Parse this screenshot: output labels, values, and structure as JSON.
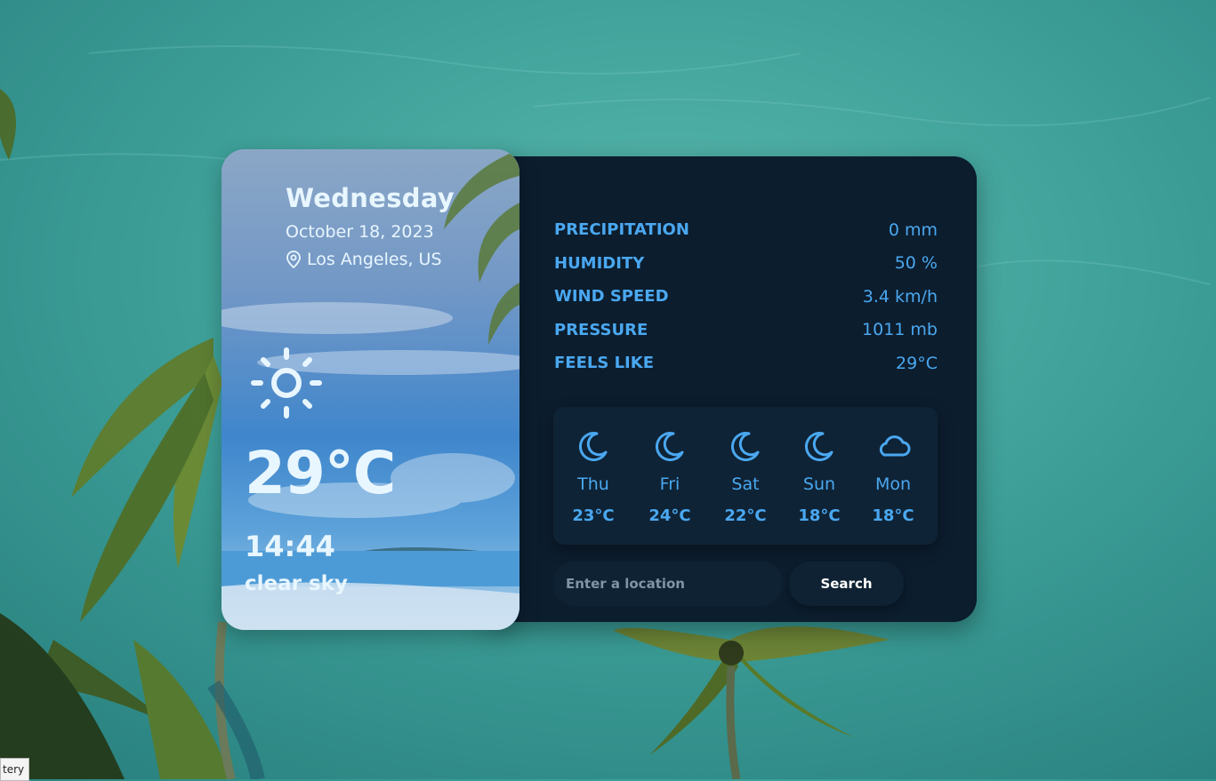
{
  "hero": {
    "day": "Wednesday",
    "date": "October 18, 2023",
    "location": "Los Angeles, US",
    "temperature": "29°C",
    "time": "14:44",
    "condition": "clear sky",
    "icon": "sun-icon"
  },
  "stats": [
    {
      "label": "PRECIPITATION",
      "value": "0 mm"
    },
    {
      "label": "HUMIDITY",
      "value": "50 %"
    },
    {
      "label": "WIND SPEED",
      "value": "3.4 km/h"
    },
    {
      "label": "PRESSURE",
      "value": "1011 mb"
    },
    {
      "label": "FEELS LIKE",
      "value": "29°C"
    }
  ],
  "forecast": [
    {
      "day": "Thu",
      "temp": "23°C",
      "icon": "moon-icon"
    },
    {
      "day": "Fri",
      "temp": "24°C",
      "icon": "moon-icon"
    },
    {
      "day": "Sat",
      "temp": "22°C",
      "icon": "moon-icon"
    },
    {
      "day": "Sun",
      "temp": "18°C",
      "icon": "moon-icon"
    },
    {
      "day": "Mon",
      "temp": "18°C",
      "icon": "cloud-icon"
    }
  ],
  "search": {
    "placeholder": "Enter a location",
    "value": "",
    "button_label": "Search"
  },
  "tooltip": "tery",
  "colors": {
    "accent": "#4aa8f0",
    "panel": "#0c1d2e",
    "text_light": "#e8f6ff"
  }
}
